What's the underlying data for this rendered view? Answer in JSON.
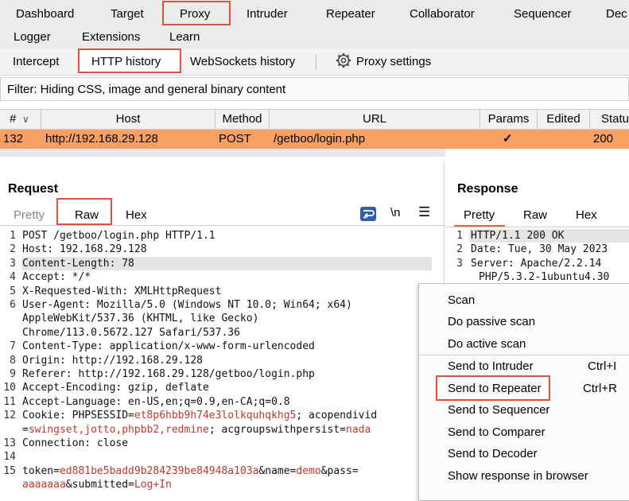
{
  "top_tabs": {
    "row1": [
      "Dashboard",
      "Target",
      "Proxy",
      "Intruder",
      "Repeater",
      "Collaborator",
      "Sequencer",
      "Dec"
    ],
    "row2": [
      "Logger",
      "Extensions",
      "Learn"
    ]
  },
  "proxy_tabs": {
    "intercept": "Intercept",
    "http_history": "HTTP history",
    "websockets_history": "WebSockets history",
    "settings": "Proxy settings"
  },
  "filter": {
    "text": "Filter: Hiding CSS, image and general binary content"
  },
  "table": {
    "headers": {
      "num": "#",
      "host": "Host",
      "method": "Method",
      "url": "URL",
      "params": "Params",
      "edited": "Edited",
      "status": "Statu"
    },
    "rows": [
      {
        "num": "132",
        "host": "http://192.168.29.128",
        "method": "POST",
        "url": "/getboo/login.php",
        "params": "✓",
        "edited": "",
        "status": "200"
      }
    ]
  },
  "request": {
    "title": "Request",
    "tabs": {
      "pretty": "Pretty",
      "raw": "Raw",
      "hex": "Hex"
    },
    "toolbar": {
      "newline": "\\n",
      "wrap_icon": "wrap-icon",
      "menu_icon": "hamburger-icon"
    },
    "lines": [
      {
        "n": "1",
        "text": "POST /getboo/login.php HTTP/1.1"
      },
      {
        "n": "2",
        "text": "Host: 192.168.29.128"
      },
      {
        "n": "3",
        "text": "Content-Length: 78"
      },
      {
        "n": "4",
        "text": "Accept: */*"
      },
      {
        "n": "5",
        "text": "X-Requested-With: XMLHttpRequest"
      },
      {
        "n": "6",
        "text": "User-Agent: Mozilla/5.0 (Windows NT 10.0; Win64; x64)"
      },
      {
        "n": "",
        "text": "AppleWebKit/537.36 (KHTML, like Gecko)"
      },
      {
        "n": "",
        "text": "Chrome/113.0.5672.127 Safari/537.36"
      },
      {
        "n": "7",
        "text": "Content-Type: application/x-www-form-urlencoded"
      },
      {
        "n": "8",
        "text": "Origin: http://192.168.29.128"
      },
      {
        "n": "9",
        "text": "Referer: http://192.168.29.128/getboo/login.php"
      },
      {
        "n": "10",
        "text": "Accept-Encoding: gzip, deflate"
      },
      {
        "n": "11",
        "text": "Accept-Language: en-US,en;q=0.9,en-CA;q=0.8"
      }
    ],
    "cookie": {
      "n": "12",
      "prefix": "Cookie: PHPSESSID=",
      "sessid": "et8p6hbb9h74e3lolkquhqkhg5",
      "mid": "; acopendivid",
      "line2_a": "=",
      "groups": "swingset,jotto,phpbb2,redmine",
      "line2_b": "; acgroupswithpersist=",
      "persist": "nada"
    },
    "connection": {
      "n": "13",
      "text": "Connection: close"
    },
    "blank": {
      "n": "14",
      "text": ""
    },
    "body": {
      "n": "15",
      "p1": "token=",
      "token": "ed881be5badd9b284239be84948a103a",
      "p2": "&name=",
      "name": "demo",
      "p3": "&pass=",
      "pass": "aaaaaaa",
      "p4": "&submitted=",
      "submitted": "Log+In"
    }
  },
  "response": {
    "title": "Response",
    "tabs": {
      "pretty": "Pretty",
      "raw": "Raw",
      "hex": "Hex"
    },
    "lines": [
      {
        "n": "1",
        "text": "HTTP/1.1 200 OK"
      },
      {
        "n": "2",
        "text": "Date: Tue, 30 May 2023"
      },
      {
        "n": "3",
        "text": "Server: Apache/2.2.14"
      },
      {
        "n": "",
        "text": "PHP/5.3.2-1ubuntu4.30"
      }
    ]
  },
  "context_menu": {
    "scan": "Scan",
    "passive": "Do passive scan",
    "active": "Do active scan",
    "intruder": "Send to Intruder",
    "intruder_sc": "Ctrl+I",
    "repeater": "Send to Repeater",
    "repeater_sc": "Ctrl+R",
    "sequencer": "Send to Sequencer",
    "comparer": "Send to Comparer",
    "decoder": "Send to Decoder",
    "show": "Show response in browser"
  },
  "colors": {
    "highlight_row": "#f6a063",
    "annotation": "#d9543f",
    "accent": "#e8692c"
  }
}
